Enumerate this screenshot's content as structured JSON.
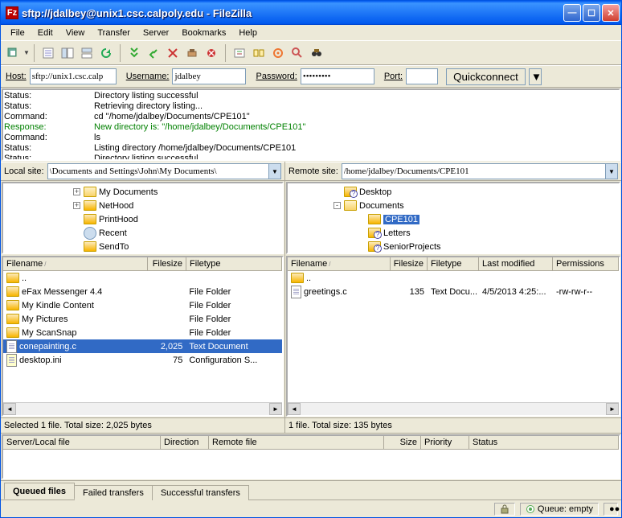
{
  "window": {
    "title": "sftp://jdalbey@unix1.csc.calpoly.edu - FileZilla",
    "app_icon_letter": "Fz"
  },
  "menu": {
    "file": "File",
    "edit": "Edit",
    "view": "View",
    "transfer": "Transfer",
    "server": "Server",
    "bookmarks": "Bookmarks",
    "help": "Help"
  },
  "conn": {
    "host_label": "Host:",
    "host_value": "sftp://unix1.csc.calp",
    "user_label": "Username:",
    "user_value": "jdalbey",
    "pass_label": "Password:",
    "pass_value": "•••••••••",
    "port_label": "Port:",
    "port_value": "",
    "quickconnect": "Quickconnect"
  },
  "log": [
    {
      "kind": "status",
      "label": "Status:",
      "text": "Directory listing successful"
    },
    {
      "kind": "status",
      "label": "Status:",
      "text": "Retrieving directory listing..."
    },
    {
      "kind": "cmd",
      "label": "Command:",
      "text": "cd \"/home/jdalbey/Documents/CPE101\""
    },
    {
      "kind": "resp",
      "label": "Response:",
      "text": "New directory is: \"/home/jdalbey/Documents/CPE101\""
    },
    {
      "kind": "cmd",
      "label": "Command:",
      "text": "ls"
    },
    {
      "kind": "status",
      "label": "Status:",
      "text": "Listing directory /home/jdalbey/Documents/CPE101"
    },
    {
      "kind": "status",
      "label": "Status:",
      "text": "Directory listing successful"
    }
  ],
  "local": {
    "site_label": "Local site:",
    "path": "\\Documents and Settings\\John\\My Documents\\",
    "tree": [
      {
        "indent": 85,
        "expander": "+",
        "icon": "folder-open",
        "label": "My Documents"
      },
      {
        "indent": 85,
        "expander": "+",
        "icon": "folder",
        "label": "NetHood"
      },
      {
        "indent": 85,
        "expander": "",
        "icon": "folder",
        "label": "PrintHood"
      },
      {
        "indent": 85,
        "expander": "",
        "icon": "recent",
        "label": "Recent"
      },
      {
        "indent": 85,
        "expander": "",
        "icon": "sendto",
        "label": "SendTo"
      }
    ],
    "columns": {
      "name": "Filename",
      "size": "Filesize",
      "type": "Filetype"
    },
    "files": [
      {
        "icon": "folder-up",
        "name": "..",
        "size": "",
        "type": ""
      },
      {
        "icon": "folder",
        "name": "eFax Messenger 4.4",
        "size": "",
        "type": "File Folder"
      },
      {
        "icon": "folder",
        "name": "My Kindle Content",
        "size": "",
        "type": "File Folder"
      },
      {
        "icon": "folder",
        "name": "My Pictures",
        "size": "",
        "type": "File Folder"
      },
      {
        "icon": "folder",
        "name": "My ScanSnap",
        "size": "",
        "type": "File Folder"
      },
      {
        "icon": "doc",
        "name": "conepainting.c",
        "size": "2,025",
        "type": "Text Document",
        "selected": true
      },
      {
        "icon": "ini",
        "name": "desktop.ini",
        "size": "75",
        "type": "Configuration S..."
      }
    ],
    "status": "Selected 1 file. Total size: 2,025 bytes"
  },
  "remote": {
    "site_label": "Remote site:",
    "path": "/home/jdalbey/Documents/CPE101",
    "tree": [
      {
        "indent": 55,
        "expander": "",
        "icon": "folderq",
        "label": "Desktop"
      },
      {
        "indent": 55,
        "expander": "-",
        "icon": "folder-open",
        "label": "Documents"
      },
      {
        "indent": 85,
        "expander": "",
        "icon": "folder",
        "label": "CPE101",
        "selected": true
      },
      {
        "indent": 85,
        "expander": "",
        "icon": "folderq",
        "label": "Letters"
      },
      {
        "indent": 85,
        "expander": "",
        "icon": "folderq",
        "label": "SeniorProjects"
      }
    ],
    "columns": {
      "name": "Filename",
      "size": "Filesize",
      "type": "Filetype",
      "modified": "Last modified",
      "perms": "Permissions"
    },
    "files": [
      {
        "icon": "folder-up",
        "name": "..",
        "size": "",
        "type": "",
        "modified": "",
        "perms": ""
      },
      {
        "icon": "doc",
        "name": "greetings.c",
        "size": "135",
        "type": "Text Docu...",
        "modified": "4/5/2013 4:25:...",
        "perms": "-rw-rw-r--"
      }
    ],
    "status": "1 file. Total size: 135 bytes"
  },
  "queue": {
    "columns": {
      "server": "Server/Local file",
      "direction": "Direction",
      "remote": "Remote file",
      "size": "Size",
      "priority": "Priority",
      "status": "Status"
    },
    "tabs": {
      "queued": "Queued files",
      "failed": "Failed transfers",
      "success": "Successful transfers"
    }
  },
  "mainstatus": {
    "queue": "Queue: empty"
  },
  "colors": {
    "accent": "#316ac5",
    "response": "#008000"
  }
}
